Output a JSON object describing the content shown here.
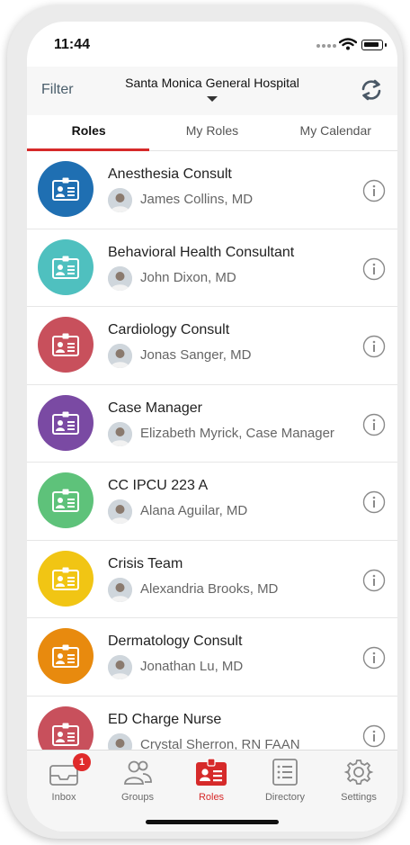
{
  "status_bar": {
    "time": "11:44"
  },
  "header": {
    "filter_label": "Filter",
    "hospital_name": "Santa Monica General Hospital",
    "refresh_icon": "refresh-icon"
  },
  "tabs": [
    {
      "label": "Roles",
      "active": true
    },
    {
      "label": "My Roles",
      "active": false
    },
    {
      "label": "My Calendar",
      "active": false
    }
  ],
  "roles": [
    {
      "name": "Anesthesia Consult",
      "assignee": "James Collins, MD",
      "color": "#1f6fb2"
    },
    {
      "name": "Behavioral Health Consultant",
      "assignee": "John Dixon, MD",
      "color": "#4fc0bf"
    },
    {
      "name": "Cardiology Consult",
      "assignee": "Jonas Sanger, MD",
      "color": "#c8505c"
    },
    {
      "name": "Case Manager",
      "assignee": "Elizabeth Myrick, Case Manager",
      "color": "#7a4aa3"
    },
    {
      "name": "CC IPCU 223 A",
      "assignee": "Alana Aguilar, MD",
      "color": "#5ec27a"
    },
    {
      "name": "Crisis Team",
      "assignee": "Alexandria Brooks, MD",
      "color": "#f1c514"
    },
    {
      "name": "Dermatology Consult",
      "assignee": "Jonathan Lu, MD",
      "color": "#e88a0e"
    },
    {
      "name": "ED Charge Nurse",
      "assignee": "Crystal Sherron, RN FAAN",
      "color": "#c8505c"
    }
  ],
  "tab_bar": {
    "inbox": {
      "label": "Inbox",
      "badge": "1",
      "icon": "inbox-icon"
    },
    "groups": {
      "label": "Groups",
      "icon": "groups-icon"
    },
    "roles": {
      "label": "Roles",
      "icon": "roles-icon",
      "active": true
    },
    "directory": {
      "label": "Directory",
      "icon": "directory-icon"
    },
    "settings": {
      "label": "Settings",
      "icon": "gear-icon"
    }
  },
  "colors": {
    "accent": "#d62a2a",
    "filter_text": "#4a5e6b"
  }
}
